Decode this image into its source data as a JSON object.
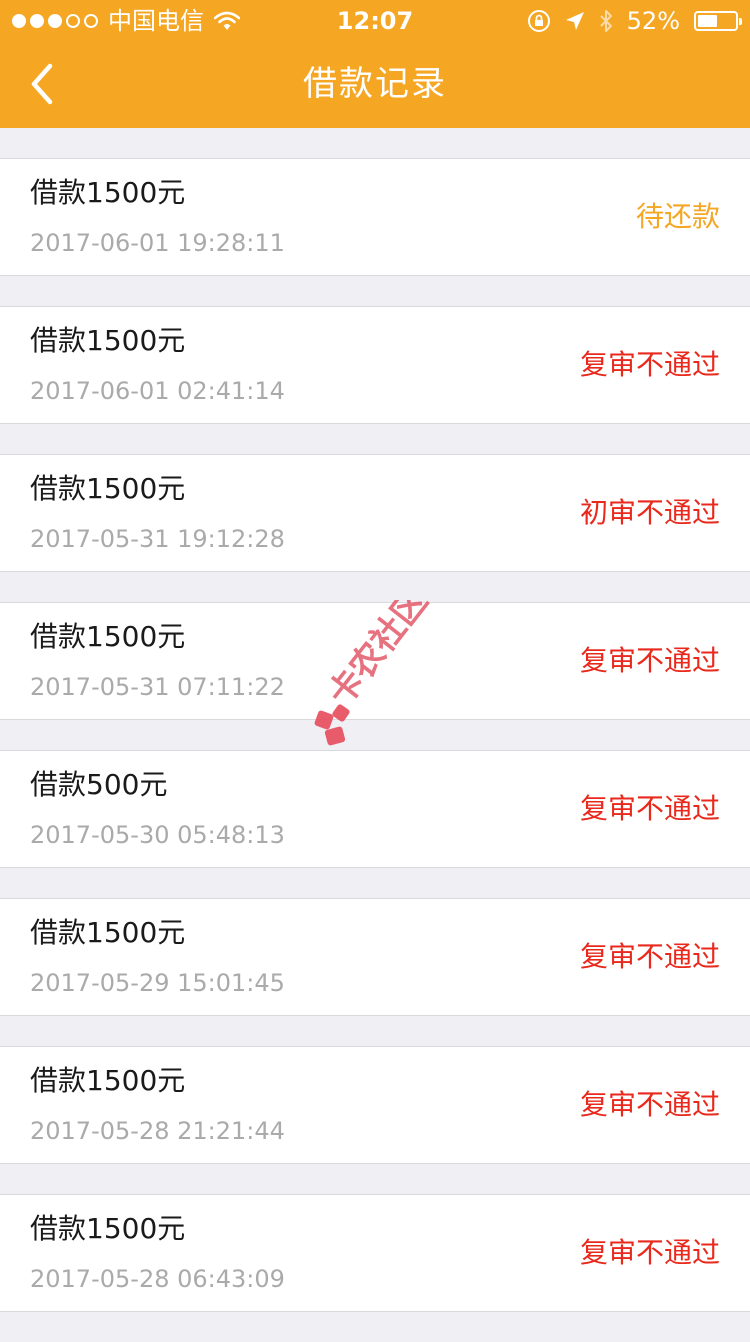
{
  "status_bar": {
    "carrier": "中国电信",
    "time": "12:07",
    "battery_percent": "52%",
    "battery_level": 0.52
  },
  "nav": {
    "title": "借款记录",
    "back_icon": "chevron-left-icon"
  },
  "records": [
    {
      "title": "借款1500元",
      "time": "2017-06-01 19:28:11",
      "status": "待还款",
      "status_color": "#f5a623"
    },
    {
      "title": "借款1500元",
      "time": "2017-06-01 02:41:14",
      "status": "复审不通过",
      "status_color": "#e8291c"
    },
    {
      "title": "借款1500元",
      "time": "2017-05-31 19:12:28",
      "status": "初审不通过",
      "status_color": "#e8291c"
    },
    {
      "title": "借款1500元",
      "time": "2017-05-31 07:11:22",
      "status": "复审不通过",
      "status_color": "#e8291c"
    },
    {
      "title": "借款500元",
      "time": "2017-05-30 05:48:13",
      "status": "复审不通过",
      "status_color": "#e8291c"
    },
    {
      "title": "借款1500元",
      "time": "2017-05-29 15:01:45",
      "status": "复审不通过",
      "status_color": "#e8291c"
    },
    {
      "title": "借款1500元",
      "time": "2017-05-28 21:21:44",
      "status": "复审不通过",
      "status_color": "#e8291c"
    },
    {
      "title": "借款1500元",
      "time": "2017-05-28 06:43:09",
      "status": "复审不通过",
      "status_color": "#e8291c"
    }
  ],
  "watermark": {
    "text": "卡农社区"
  },
  "colors": {
    "accent": "#f5a623",
    "failed": "#e8291c",
    "background": "#efeff4"
  }
}
